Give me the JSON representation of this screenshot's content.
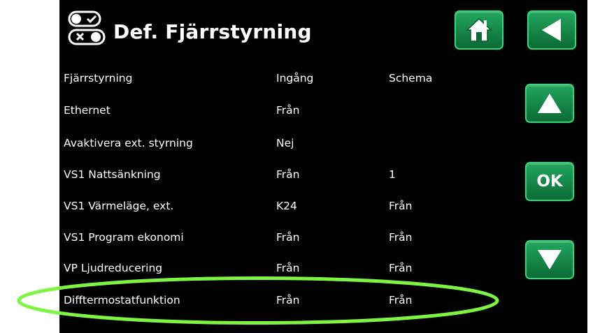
{
  "header": {
    "title": "Def. Fjärrstyrning",
    "icon": "remote-toggle-icon"
  },
  "buttons": {
    "home": "home-icon",
    "back": "back-arrow-icon",
    "up": "arrow-up-icon",
    "ok_label": "OK",
    "down": "arrow-down-icon",
    "color": "#189a4f"
  },
  "table": {
    "columns": [
      "Fjärrstyrning",
      "Ingång",
      "Schema"
    ],
    "rows": [
      {
        "name": "Ethernet",
        "input": "Från",
        "schedule": ""
      },
      {
        "name": "Avaktivera ext. styrning",
        "input": "Nej",
        "schedule": ""
      },
      {
        "name": "VS1 Nattsänkning",
        "input": "Från",
        "schedule": "1"
      },
      {
        "name": "VS1 Värmeläge, ext.",
        "input": "K24",
        "schedule": "Från"
      },
      {
        "name": "VS1 Program ekonomi",
        "input": "Från",
        "schedule": "Från"
      },
      {
        "name": "VP Ljudreducering",
        "input": "Från",
        "schedule": "Från"
      },
      {
        "name": "Difftermostatfunktion",
        "input": "Från",
        "schedule": "Från"
      }
    ]
  },
  "highlight": {
    "color": "#7ef542",
    "target_row": "Difftermostatfunktion"
  }
}
